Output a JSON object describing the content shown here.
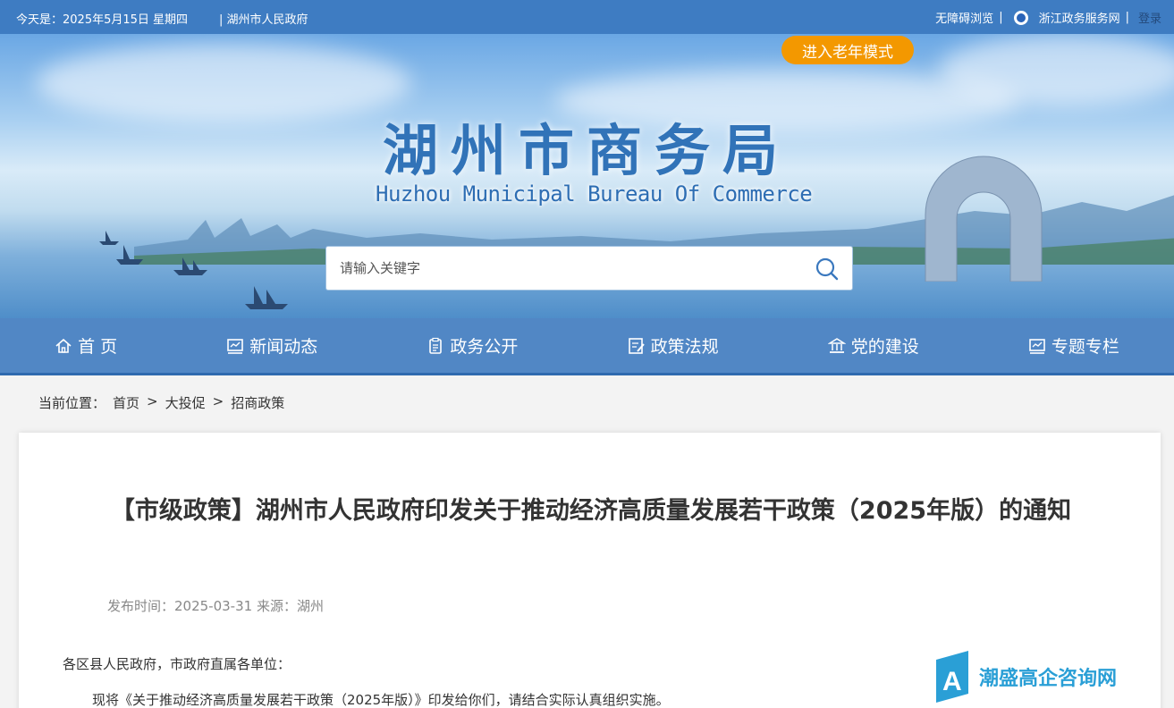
{
  "topbar": {
    "date": "今天是：2025年5月15日 星期四",
    "gov_link": "| 湖州市人民政府",
    "accessible": "无障碍浏览",
    "service": "浙江政务服务网",
    "login": "登录"
  },
  "banner": {
    "elder_mode": "进入老年模式",
    "title_cn": "湖州市商务局",
    "title_en": "Huzhou Municipal Bureau Of Commerce",
    "search_placeholder": "请输入关键字"
  },
  "nav": {
    "items": [
      {
        "label": "首 页",
        "icon": "home-icon"
      },
      {
        "label": "新闻动态",
        "icon": "chart-icon"
      },
      {
        "label": "政务公开",
        "icon": "clipboard-icon"
      },
      {
        "label": "政策法规",
        "icon": "edit-icon"
      },
      {
        "label": "党的建设",
        "icon": "building-icon"
      },
      {
        "label": "专题专栏",
        "icon": "chart-icon"
      }
    ]
  },
  "breadcrumb": {
    "prefix": "当前位置：",
    "items": [
      "首页",
      "大投促",
      "招商政策"
    ],
    "sep": ">"
  },
  "article": {
    "title": "【市级政策】湖州市人民政府印发关于推动经济高质量发展若干政策（2025年版）的通知",
    "meta": "发布时间：2025-03-31 来源：湖州",
    "p1": "各区县人民政府，市政府直属各单位：",
    "p2": "现将《关于推动经济高质量发展若干政策（2025年版）》印发给你们，请结合实际认真组织实施。"
  },
  "watermark": {
    "text": "潮盛高企咨询网"
  },
  "colors": {
    "topbar": "#3e7cc2",
    "nav": "#3a78be",
    "accent": "#f39800",
    "title_blue": "#3173b8"
  }
}
